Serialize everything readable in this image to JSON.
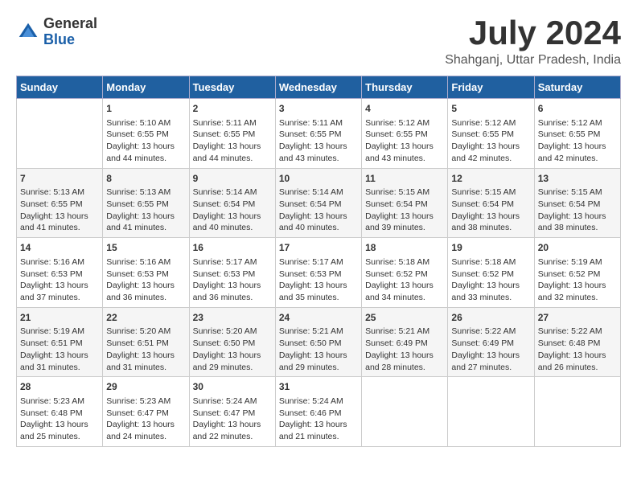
{
  "header": {
    "logo_general": "General",
    "logo_blue": "Blue",
    "title": "July 2024",
    "location": "Shahganj, Uttar Pradesh, India"
  },
  "calendar": {
    "days_of_week": [
      "Sunday",
      "Monday",
      "Tuesday",
      "Wednesday",
      "Thursday",
      "Friday",
      "Saturday"
    ],
    "weeks": [
      [
        {
          "day": "",
          "content": ""
        },
        {
          "day": "1",
          "content": "Sunrise: 5:10 AM\nSunset: 6:55 PM\nDaylight: 13 hours\nand 44 minutes."
        },
        {
          "day": "2",
          "content": "Sunrise: 5:11 AM\nSunset: 6:55 PM\nDaylight: 13 hours\nand 44 minutes."
        },
        {
          "day": "3",
          "content": "Sunrise: 5:11 AM\nSunset: 6:55 PM\nDaylight: 13 hours\nand 43 minutes."
        },
        {
          "day": "4",
          "content": "Sunrise: 5:12 AM\nSunset: 6:55 PM\nDaylight: 13 hours\nand 43 minutes."
        },
        {
          "day": "5",
          "content": "Sunrise: 5:12 AM\nSunset: 6:55 PM\nDaylight: 13 hours\nand 42 minutes."
        },
        {
          "day": "6",
          "content": "Sunrise: 5:12 AM\nSunset: 6:55 PM\nDaylight: 13 hours\nand 42 minutes."
        }
      ],
      [
        {
          "day": "7",
          "content": "Sunrise: 5:13 AM\nSunset: 6:55 PM\nDaylight: 13 hours\nand 41 minutes."
        },
        {
          "day": "8",
          "content": "Sunrise: 5:13 AM\nSunset: 6:55 PM\nDaylight: 13 hours\nand 41 minutes."
        },
        {
          "day": "9",
          "content": "Sunrise: 5:14 AM\nSunset: 6:54 PM\nDaylight: 13 hours\nand 40 minutes."
        },
        {
          "day": "10",
          "content": "Sunrise: 5:14 AM\nSunset: 6:54 PM\nDaylight: 13 hours\nand 40 minutes."
        },
        {
          "day": "11",
          "content": "Sunrise: 5:15 AM\nSunset: 6:54 PM\nDaylight: 13 hours\nand 39 minutes."
        },
        {
          "day": "12",
          "content": "Sunrise: 5:15 AM\nSunset: 6:54 PM\nDaylight: 13 hours\nand 38 minutes."
        },
        {
          "day": "13",
          "content": "Sunrise: 5:15 AM\nSunset: 6:54 PM\nDaylight: 13 hours\nand 38 minutes."
        }
      ],
      [
        {
          "day": "14",
          "content": "Sunrise: 5:16 AM\nSunset: 6:53 PM\nDaylight: 13 hours\nand 37 minutes."
        },
        {
          "day": "15",
          "content": "Sunrise: 5:16 AM\nSunset: 6:53 PM\nDaylight: 13 hours\nand 36 minutes."
        },
        {
          "day": "16",
          "content": "Sunrise: 5:17 AM\nSunset: 6:53 PM\nDaylight: 13 hours\nand 36 minutes."
        },
        {
          "day": "17",
          "content": "Sunrise: 5:17 AM\nSunset: 6:53 PM\nDaylight: 13 hours\nand 35 minutes."
        },
        {
          "day": "18",
          "content": "Sunrise: 5:18 AM\nSunset: 6:52 PM\nDaylight: 13 hours\nand 34 minutes."
        },
        {
          "day": "19",
          "content": "Sunrise: 5:18 AM\nSunset: 6:52 PM\nDaylight: 13 hours\nand 33 minutes."
        },
        {
          "day": "20",
          "content": "Sunrise: 5:19 AM\nSunset: 6:52 PM\nDaylight: 13 hours\nand 32 minutes."
        }
      ],
      [
        {
          "day": "21",
          "content": "Sunrise: 5:19 AM\nSunset: 6:51 PM\nDaylight: 13 hours\nand 31 minutes."
        },
        {
          "day": "22",
          "content": "Sunrise: 5:20 AM\nSunset: 6:51 PM\nDaylight: 13 hours\nand 31 minutes."
        },
        {
          "day": "23",
          "content": "Sunrise: 5:20 AM\nSunset: 6:50 PM\nDaylight: 13 hours\nand 29 minutes."
        },
        {
          "day": "24",
          "content": "Sunrise: 5:21 AM\nSunset: 6:50 PM\nDaylight: 13 hours\nand 29 minutes."
        },
        {
          "day": "25",
          "content": "Sunrise: 5:21 AM\nSunset: 6:49 PM\nDaylight: 13 hours\nand 28 minutes."
        },
        {
          "day": "26",
          "content": "Sunrise: 5:22 AM\nSunset: 6:49 PM\nDaylight: 13 hours\nand 27 minutes."
        },
        {
          "day": "27",
          "content": "Sunrise: 5:22 AM\nSunset: 6:48 PM\nDaylight: 13 hours\nand 26 minutes."
        }
      ],
      [
        {
          "day": "28",
          "content": "Sunrise: 5:23 AM\nSunset: 6:48 PM\nDaylight: 13 hours\nand 25 minutes."
        },
        {
          "day": "29",
          "content": "Sunrise: 5:23 AM\nSunset: 6:47 PM\nDaylight: 13 hours\nand 24 minutes."
        },
        {
          "day": "30",
          "content": "Sunrise: 5:24 AM\nSunset: 6:47 PM\nDaylight: 13 hours\nand 22 minutes."
        },
        {
          "day": "31",
          "content": "Sunrise: 5:24 AM\nSunset: 6:46 PM\nDaylight: 13 hours\nand 21 minutes."
        },
        {
          "day": "",
          "content": ""
        },
        {
          "day": "",
          "content": ""
        },
        {
          "day": "",
          "content": ""
        }
      ]
    ]
  }
}
